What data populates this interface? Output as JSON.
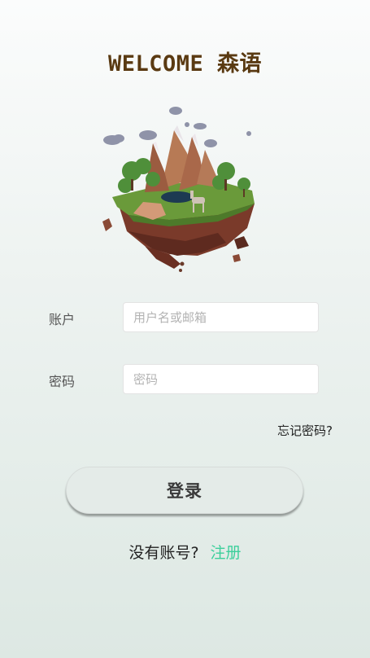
{
  "header": {
    "title": "WELCOME 森语"
  },
  "login_form": {
    "account_label": "账户",
    "account_placeholder": "用户名或邮箱",
    "password_label": "密码",
    "password_placeholder": "密码",
    "forgot_password": "忘记密码?",
    "submit_label": "登录"
  },
  "register": {
    "prompt": "没有账号?",
    "link_label": "注册"
  },
  "colors": {
    "title": "#5a3a12",
    "link_accent": "#3ccf9b",
    "button_bg": "#e4ebe8"
  },
  "icons": {
    "illustration": "floating-island-illustration"
  }
}
